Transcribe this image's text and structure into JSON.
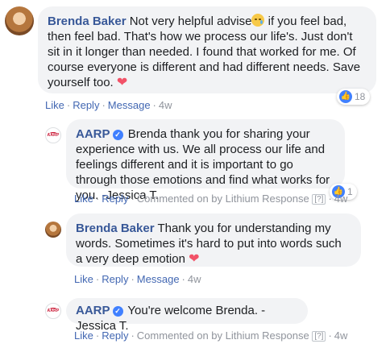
{
  "comments": [
    {
      "author": "Brenda Baker",
      "text_part1": "Not very helpful advise",
      "emoji": "crying-face-icon",
      "text_part2": " if you feel bad, then feel bad. That's how we process our life's. Just don't sit in it longer than needed. I found that worked for me. Of course everyone is different and had different needs. Save yourself too.",
      "trailing_emoji": "heart-icon",
      "actions": {
        "like": "Like",
        "reply": "Reply",
        "message": "Message",
        "time": "4w"
      },
      "reaction_count": "18"
    },
    {
      "author": "AARP",
      "verified": true,
      "text": "Brenda thank you for sharing your experience with us. We all process our life and feelings different and it is important to go through those emotions and find what works for you. -Jessica T.",
      "actions": {
        "like": "Like",
        "reply": "Reply",
        "commented_on_by": "Commented on by Lithium Response",
        "info": "[?]",
        "time": "4w"
      },
      "reaction_count": "1"
    },
    {
      "author": "Brenda Baker",
      "text": "Thank you for understanding my words. Sometimes it's hard to put into words such a very deep emotion",
      "trailing_emoji": "heart-icon",
      "actions": {
        "like": "Like",
        "reply": "Reply",
        "message": "Message",
        "time": "4w"
      }
    },
    {
      "author": "AARP",
      "verified": true,
      "text": "You're welcome Brenda. -Jessica T.",
      "actions": {
        "like": "Like",
        "reply": "Reply",
        "commented_on_by": "Commented on by Lithium Response",
        "info": "[?]",
        "time": "4w"
      }
    }
  ],
  "logo_text": "AARP",
  "colors": {
    "name": "#385898",
    "link": "#4267b2",
    "bubble": "#f2f3f5",
    "like": "#4080ff",
    "heart": "#f25268"
  }
}
